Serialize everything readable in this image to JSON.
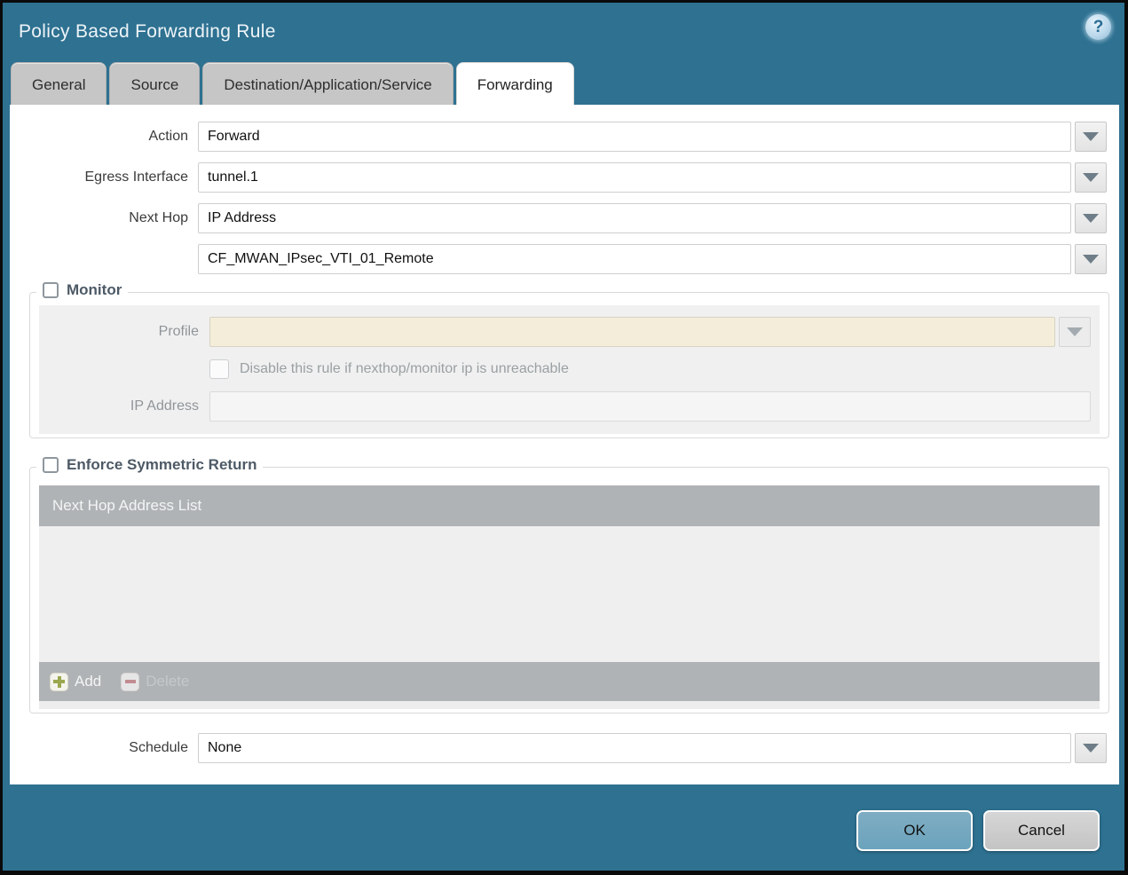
{
  "dialog": {
    "title": "Policy Based Forwarding Rule",
    "help_glyph": "?"
  },
  "tabs": [
    {
      "label": "General",
      "active": false
    },
    {
      "label": "Source",
      "active": false
    },
    {
      "label": "Destination/Application/Service",
      "active": false
    },
    {
      "label": "Forwarding",
      "active": true
    }
  ],
  "form": {
    "action": {
      "label": "Action",
      "value": "Forward"
    },
    "egress_interface": {
      "label": "Egress Interface",
      "value": "tunnel.1"
    },
    "next_hop": {
      "label": "Next Hop",
      "value": "IP Address"
    },
    "next_hop_address": {
      "value": "CF_MWAN_IPsec_VTI_01_Remote"
    },
    "schedule": {
      "label": "Schedule",
      "value": "None"
    }
  },
  "monitor": {
    "label": "Monitor",
    "checked": false,
    "profile": {
      "label": "Profile",
      "value": ""
    },
    "disable_rule": {
      "label": "Disable this rule if nexthop/monitor ip is unreachable",
      "checked": false
    },
    "ip_address": {
      "label": "IP Address",
      "value": ""
    }
  },
  "symmetric_return": {
    "label": "Enforce Symmetric Return",
    "checked": false,
    "table": {
      "header": "Next Hop Address List",
      "rows": []
    },
    "add_label": "Add",
    "delete_label": "Delete",
    "delete_enabled": false
  },
  "footer": {
    "ok_label": "OK",
    "cancel_label": "Cancel"
  },
  "colors": {
    "titlebar_teal": "#2E7191",
    "inactive_tab_bg": "#C6C6C6",
    "active_tab_bg": "#FFFFFF",
    "ok_button": "#6BA3BC",
    "cancel_button": "#C9C9C9",
    "profile_disabled_bg": "#F3EDDA",
    "disabled_panel_bg": "#F0F0F0",
    "table_header_bg": "#B0B3B5",
    "add_icon_green": "#9AA84F",
    "delete_icon_red": "#C5878B",
    "section_label": "#4D5A66"
  }
}
